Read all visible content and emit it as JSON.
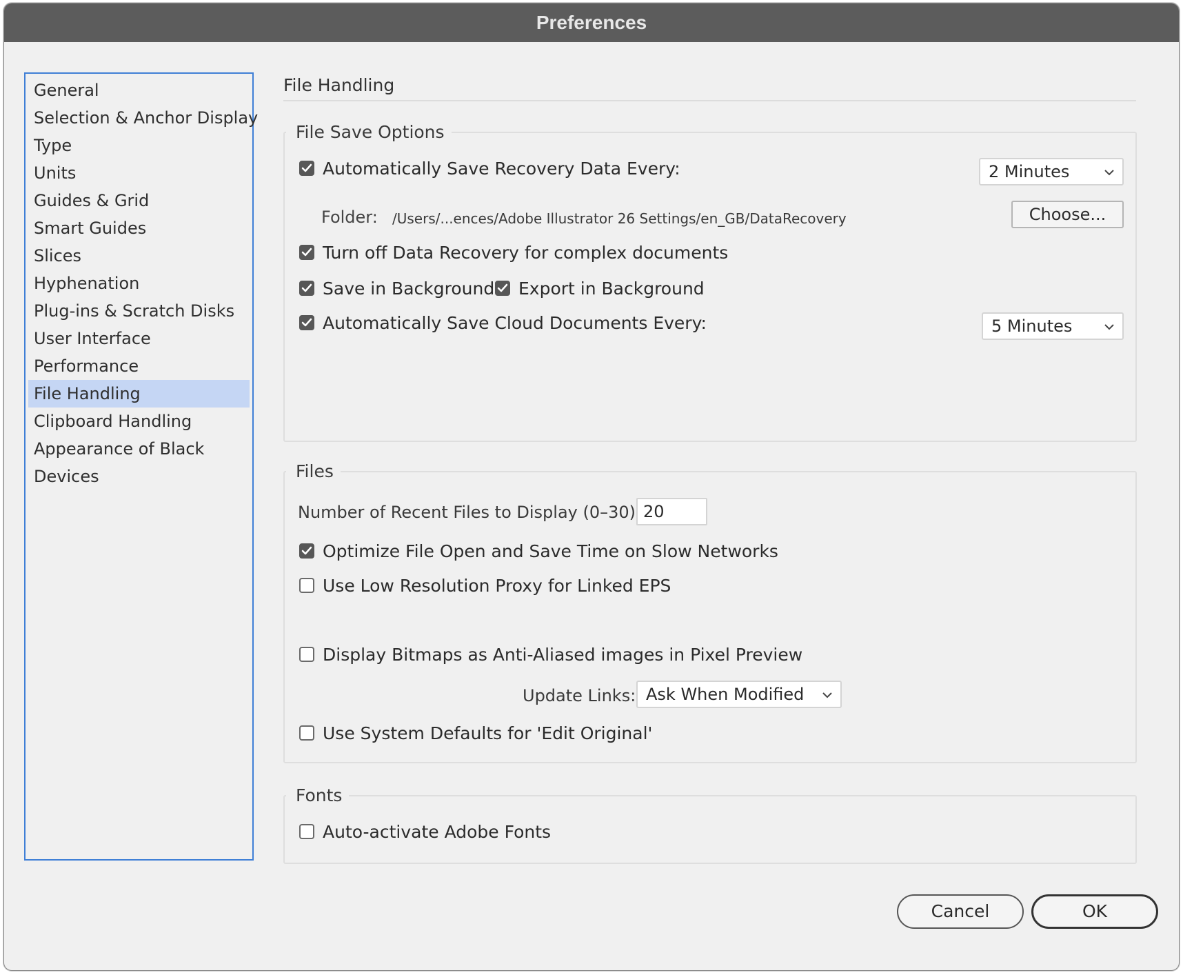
{
  "window": {
    "title": "Preferences"
  },
  "sidebar": {
    "items": [
      {
        "label": "General",
        "active": false
      },
      {
        "label": "Selection & Anchor Display",
        "active": false
      },
      {
        "label": "Type",
        "active": false
      },
      {
        "label": "Units",
        "active": false
      },
      {
        "label": "Guides & Grid",
        "active": false
      },
      {
        "label": "Smart Guides",
        "active": false
      },
      {
        "label": "Slices",
        "active": false
      },
      {
        "label": "Hyphenation",
        "active": false
      },
      {
        "label": "Plug-ins & Scratch Disks",
        "active": false
      },
      {
        "label": "User Interface",
        "active": false
      },
      {
        "label": "Performance",
        "active": false
      },
      {
        "label": "File Handling",
        "active": true
      },
      {
        "label": "Clipboard Handling",
        "active": false
      },
      {
        "label": "Appearance of Black",
        "active": false
      },
      {
        "label": "Devices",
        "active": false
      }
    ]
  },
  "main": {
    "title": "File Handling",
    "file_save_options": {
      "legend": "File Save Options",
      "auto_save_recovery": {
        "label": "Automatically Save Recovery Data Every:",
        "checked": true
      },
      "recovery_interval": {
        "value": "2 Minutes"
      },
      "folder": {
        "label": "Folder:",
        "path": "/Users/...ences/Adobe Illustrator 26 Settings/en_GB/DataRecovery",
        "choose_label": "Choose..."
      },
      "turn_off_recovery": {
        "label": "Turn off Data Recovery for complex documents",
        "checked": true
      },
      "save_in_background": {
        "label": "Save in Background",
        "checked": true
      },
      "export_in_background": {
        "label": "Export in Background",
        "checked": true
      },
      "auto_save_cloud": {
        "label": "Automatically Save Cloud Documents Every:",
        "checked": true
      },
      "cloud_interval": {
        "value": "5 Minutes"
      }
    },
    "files": {
      "legend": "Files",
      "recent_files": {
        "label": "Number of Recent Files to Display (0–30):",
        "value": "20"
      },
      "optimize_slow_networks": {
        "label": "Optimize File Open and Save Time on Slow Networks",
        "checked": true
      },
      "low_res_proxy": {
        "label": "Use Low Resolution Proxy for Linked EPS",
        "checked": false
      },
      "anti_aliased_bitmaps": {
        "label": "Display Bitmaps as Anti-Aliased images in Pixel Preview",
        "checked": false
      },
      "update_links": {
        "label": "Update Links:",
        "value": "Ask When Modified"
      },
      "system_defaults_edit": {
        "label": "Use System Defaults for 'Edit Original'",
        "checked": false
      }
    },
    "fonts": {
      "legend": "Fonts",
      "auto_activate": {
        "label": "Auto-activate Adobe Fonts",
        "checked": false
      }
    }
  },
  "footer": {
    "cancel_label": "Cancel",
    "ok_label": "OK"
  },
  "colors": {
    "titlebar": "#5c5c5c",
    "sidebar_border": "#3f7fd6",
    "sidebar_active": "#c5d6f4",
    "checkbox_on": "#575757"
  }
}
